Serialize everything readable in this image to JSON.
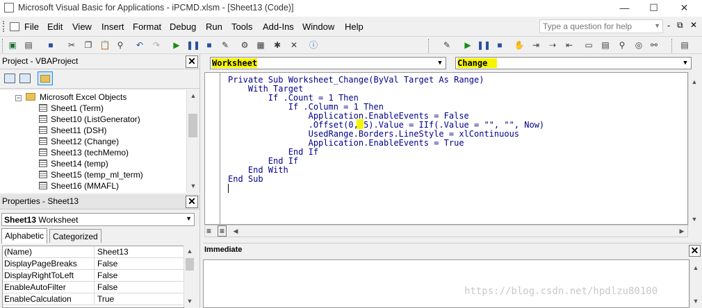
{
  "window": {
    "title": "Microsoft Visual Basic for Applications - iPCMD.xlsm - [Sheet13 (Code)]",
    "minimize": "—",
    "maximize": "☐",
    "close": "✕"
  },
  "menu": {
    "items": [
      "File",
      "Edit",
      "View",
      "Insert",
      "Format",
      "Debug",
      "Run",
      "Tools",
      "Add-Ins",
      "Window",
      "Help"
    ],
    "help_placeholder": "Type a question for help",
    "doc_controls": [
      "-",
      "⧉",
      "✕"
    ]
  },
  "project_pane": {
    "title": "Project - VBAProject",
    "tree": [
      {
        "label": "Microsoft Excel Objects",
        "type": "folder"
      },
      {
        "label": "Sheet1 (Term)",
        "type": "sheet"
      },
      {
        "label": "Sheet10 (ListGenerator)",
        "type": "sheet"
      },
      {
        "label": "Sheet11 (DSH)",
        "type": "sheet"
      },
      {
        "label": "Sheet12 (Change)",
        "type": "sheet"
      },
      {
        "label": "Sheet13 (techMemo)",
        "type": "sheet"
      },
      {
        "label": "Sheet14 (temp)",
        "type": "sheet"
      },
      {
        "label": "Sheet15 (temp_ml_term)",
        "type": "sheet"
      },
      {
        "label": "Sheet16 (MMAFL)",
        "type": "sheet"
      }
    ]
  },
  "properties_pane": {
    "title": "Properties - Sheet13",
    "object_name": "Sheet13",
    "object_type": "Worksheet",
    "tabs": [
      "Alphabetic",
      "Categorized"
    ],
    "rows": [
      {
        "name": "(Name)",
        "value": "Sheet13"
      },
      {
        "name": "DisplayPageBreaks",
        "value": "False"
      },
      {
        "name": "DisplayRightToLeft",
        "value": "False"
      },
      {
        "name": "EnableAutoFilter",
        "value": "False"
      },
      {
        "name": "EnableCalculation",
        "value": "True"
      }
    ]
  },
  "code_window": {
    "object_combo": "Worksheet",
    "procedure_combo": "Change",
    "lines": [
      "Private Sub Worksheet_Change(ByVal Target As Range)",
      "    With Target",
      "        If .Count = 1 Then",
      "            If .Column = 1 Then",
      "                Application.EnableEvents = False",
      "                .Offset(0, 5).Value = IIf(.Value = \"\", \"\", Now)",
      "                UsedRange.Borders.LineStyle = xlContinuous",
      "                Application.EnableEvents = True",
      "            End If",
      "        End If",
      "    End With",
      "End Sub"
    ],
    "highlight_text": "5"
  },
  "immediate": {
    "title": "Immediate"
  },
  "watermark": "https://blog.csdn.net/hpdlzu80100"
}
